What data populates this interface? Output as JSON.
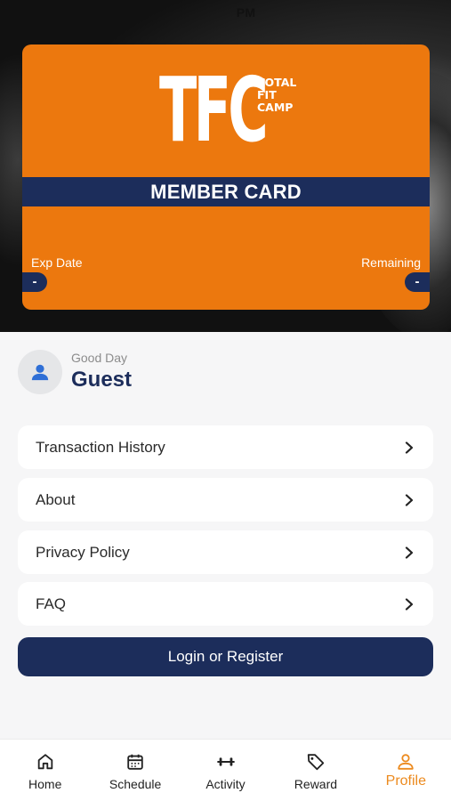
{
  "status_bar": {
    "time_fragment": "PM"
  },
  "member_card": {
    "logo_letters": "TFC",
    "logo_sub": [
      "TOTAL",
      "FIT",
      "CAMP"
    ],
    "title": "MEMBER CARD",
    "exp_label": "Exp Date",
    "exp_value": "-",
    "remaining_label": "Remaining",
    "remaining_value": "-",
    "colors": {
      "card": "#ec780e",
      "band": "#1c2d5b"
    }
  },
  "greeting": {
    "subtitle": "Good Day",
    "name": "Guest"
  },
  "menu": [
    {
      "label": "Transaction History"
    },
    {
      "label": "About"
    },
    {
      "label": "Privacy Policy"
    },
    {
      "label": "FAQ"
    }
  ],
  "login_button": {
    "label": "Login or Register"
  },
  "tabbar": [
    {
      "label": "Home",
      "icon": "home-icon"
    },
    {
      "label": "Schedule",
      "icon": "calendar-icon"
    },
    {
      "label": "Activity",
      "icon": "dumbbell-icon"
    },
    {
      "label": "Reward",
      "icon": "tag-icon"
    },
    {
      "label": "Profile",
      "icon": "user-icon",
      "active": true
    }
  ],
  "accent_color": "#ec8a1e"
}
